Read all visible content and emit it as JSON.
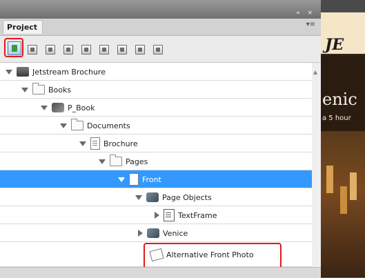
{
  "panel": {
    "tab_label": "Project",
    "topbar_controls": "« ×",
    "menu_icon": "▾≡"
  },
  "tree": [
    {
      "label": "Jetstream Brochure",
      "icon": "book-icon",
      "expanded": true
    },
    {
      "label": "Books",
      "icon": "folder-icon",
      "expanded": true
    },
    {
      "label": "P_Book",
      "icon": "publication-book-icon",
      "expanded": true
    },
    {
      "label": "Documents",
      "icon": "folder-icon",
      "expanded": true
    },
    {
      "label": "Brochure",
      "icon": "document-icon",
      "expanded": true
    },
    {
      "label": "Pages",
      "icon": "folder-icon",
      "expanded": true
    },
    {
      "label": "Front",
      "icon": "page-icon",
      "expanded": true,
      "selected": true
    },
    {
      "label": "Page Objects",
      "icon": "page-objects-icon",
      "expanded": true
    },
    {
      "label": "TextFrame",
      "icon": "text-frame-icon",
      "expanded": false
    },
    {
      "label": "Venice",
      "icon": "page-objects-icon",
      "expanded": false
    },
    {
      "label": "Alternative Front Photo",
      "icon": "alternate-layout-icon"
    }
  ],
  "preview": {
    "logo": "JE",
    "title": "enic",
    "subtitle": "a 5 hour"
  },
  "colors": {
    "selection": "#3399ff",
    "highlight_box": "#e01818"
  }
}
